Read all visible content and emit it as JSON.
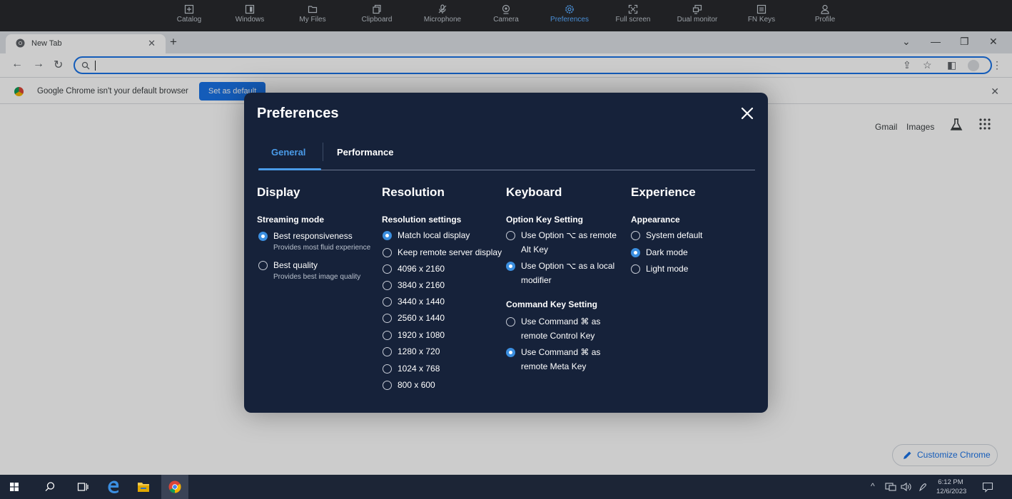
{
  "toolbar": {
    "items": [
      {
        "label": "Catalog",
        "icon": "plus-square-icon"
      },
      {
        "label": "Windows",
        "icon": "window-icon"
      },
      {
        "label": "My Files",
        "icon": "folder-icon"
      },
      {
        "label": "Clipboard",
        "icon": "clipboard-icon"
      },
      {
        "label": "Microphone",
        "icon": "microphone-off-icon"
      },
      {
        "label": "Camera",
        "icon": "camera-icon"
      },
      {
        "label": "Preferences",
        "icon": "gear-icon"
      },
      {
        "label": "Full screen",
        "icon": "fullscreen-icon"
      },
      {
        "label": "Dual monitor",
        "icon": "dual-monitor-icon"
      },
      {
        "label": "FN Keys",
        "icon": "keyboard-icon"
      },
      {
        "label": "Profile",
        "icon": "profile-icon"
      }
    ],
    "active": "Preferences"
  },
  "browser": {
    "tab_title": "New Tab",
    "new_tab": "+",
    "infobar_message": "Google Chrome isn't your default browser",
    "set_default_label": "Set as default",
    "links": {
      "gmail": "Gmail",
      "images": "Images"
    },
    "customize_label": "Customize Chrome"
  },
  "dialog": {
    "title": "Preferences",
    "tabs": {
      "general": "General",
      "performance": "Performance"
    },
    "active_tab": "General",
    "display": {
      "title": "Display",
      "streaming_mode": "Streaming mode",
      "best_responsiveness": "Best responsiveness",
      "best_responsiveness_desc": "Provides most fluid experience",
      "best_quality": "Best quality",
      "best_quality_desc": "Provides best image quality",
      "selected": "Best responsiveness"
    },
    "resolution": {
      "title": "Resolution",
      "settings_label": "Resolution settings",
      "options": [
        "Match local display",
        "Keep remote server display",
        "4096 x 2160",
        "3840 x 2160",
        "3440 x 1440",
        "2560 x 1440",
        "1920 x 1080",
        "1280 x 720",
        "1024 x 768",
        "800 x 600"
      ],
      "selected": "Match local display"
    },
    "keyboard": {
      "title": "Keyboard",
      "option_key_label": "Option Key Setting",
      "opt_remote_1": "Use Option ⌥ as remote",
      "opt_remote_2": "Alt Key",
      "opt_local_1": "Use Option ⌥ as a local",
      "opt_local_2": "modifier",
      "option_selected": "local modifier",
      "command_key_label": "Command Key Setting",
      "cmd_control_1": "Use Command ⌘ as",
      "cmd_control_2": "remote Control Key",
      "cmd_meta_1": "Use Command ⌘ as",
      "cmd_meta_2": "remote Meta Key",
      "command_selected": "remote Meta Key"
    },
    "experience": {
      "title": "Experience",
      "appearance_label": "Appearance",
      "options": [
        "System default",
        "Dark mode",
        "Light mode"
      ],
      "selected": "Dark mode"
    }
  },
  "taskbar": {
    "time": "6:12 PM",
    "date": "12/6/2023"
  },
  "colors": {
    "dialog_bg": "#16223a",
    "accent": "#4a9be8",
    "toolbar_bg": "#202124",
    "taskbar_bg": "#1c2536",
    "chrome_blue": "#1a73e8"
  }
}
